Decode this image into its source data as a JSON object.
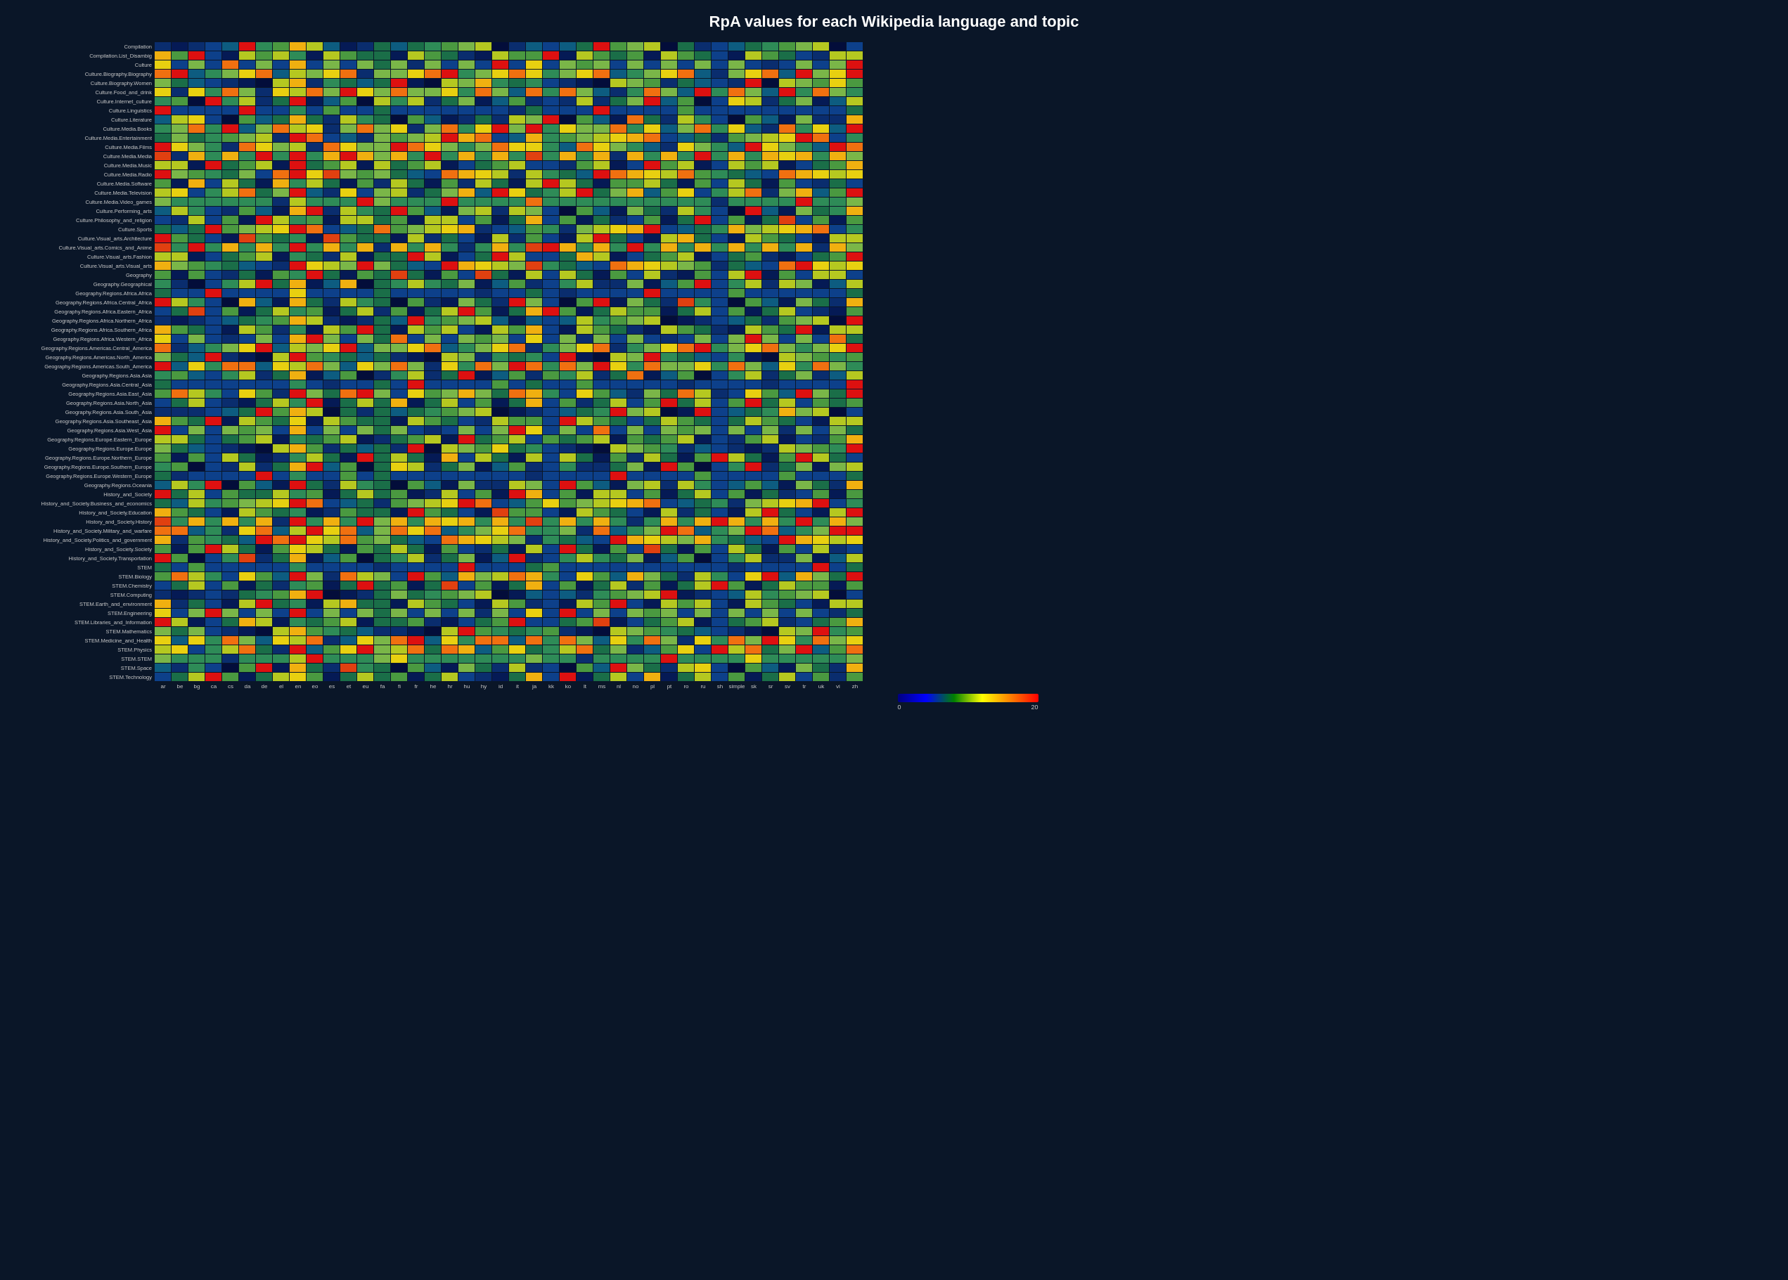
{
  "title": "RpA values for each Wikipedia language and topic",
  "legend": {
    "min": "0",
    "mid": "20",
    "gradient_start": "#000080",
    "gradient_end": "#ff0000"
  },
  "y_labels": [
    "Compilation",
    "Compilation.List_Disambig",
    "Culture",
    "Culture.Biography.Biography",
    "Culture.Biography.Women",
    "Culture.Food_and_drink",
    "Culture.Internet_culture",
    "Culture.Linguistics",
    "Culture.Literature",
    "Culture.Media.Books",
    "Culture.Media.Entertainment",
    "Culture.Media.Films",
    "Culture.Media.Media",
    "Culture.Media.Music",
    "Culture.Media.Radio",
    "Culture.Media.Software",
    "Culture.Media.Television",
    "Culture.Media.Video_games",
    "Culture.Performing_arts",
    "Culture.Philosophy_and_religion",
    "Culture.Sports",
    "Culture.Visual_arts.Architecture",
    "Culture.Visual_arts.Comics_and_Anime",
    "Culture.Visual_arts.Fashion",
    "Culture.Visual_arts.Visual_arts",
    "Geography",
    "Geography.Geographical",
    "Geography.Regions.Africa.Africa",
    "Geography.Regions.Africa.Central_Africa",
    "Geography.Regions.Africa.Eastern_Africa",
    "Geography.Regions.Africa.Northern_Africa",
    "Geography.Regions.Africa.Southern_Africa",
    "Geography.Regions.Africa.Western_Africa",
    "Geography.Regions.Americas.Central_America",
    "Geography.Regions.Americas.North_America",
    "Geography.Regions.Americas.South_America",
    "Geography.Regions.Asia.Asia",
    "Geography.Regions.Asia.Central_Asia",
    "Geography.Regions.Asia.East_Asia",
    "Geography.Regions.Asia.North_Asia",
    "Geography.Regions.Asia.South_Asia",
    "Geography.Regions.Asia.Southeast_Asia",
    "Geography.Regions.Asia.West_Asia",
    "Geography.Regions.Europe.Eastern_Europe",
    "Geography.Regions.Europe.Europe",
    "Geography.Regions.Europe.Northern_Europe",
    "Geography.Regions.Europe.Southern_Europe",
    "Geography.Regions.Europe.Western_Europe",
    "Geography.Regions.Oceania",
    "History_and_Society",
    "History_and_Society.Business_and_economics",
    "History_and_Society.Education",
    "History_and_Society.History",
    "History_and_Society.Military_and_warfare",
    "History_and_Society.Politics_and_government",
    "History_and_Society.Society",
    "History_and_Society.Transportation",
    "STEM",
    "STEM.Biology",
    "STEM.Chemistry",
    "STEM.Computing",
    "STEM.Earth_and_environment",
    "STEM.Engineering",
    "STEM.Libraries_and_Information",
    "STEM.Mathematics",
    "STEM.Medicine_and_Health",
    "STEM.Physics",
    "STEM.STEM",
    "STEM.Space",
    "STEM.Technology"
  ],
  "x_labels": [
    "ar",
    "be",
    "bg",
    "ca",
    "cs",
    "da",
    "de",
    "el",
    "en",
    "eo",
    "es",
    "et",
    "eu",
    "fa",
    "fi",
    "fr",
    "he",
    "hr",
    "hu",
    "hy",
    "id",
    "it",
    "ja",
    "kk",
    "ko",
    "lt",
    "ms",
    "nl",
    "no",
    "pl",
    "pt",
    "ro",
    "ru",
    "sh",
    "simple",
    "sk",
    "sr",
    "sv",
    "tr",
    "uk",
    "vi",
    "zh"
  ],
  "colors": {
    "v_low": "#030d3a",
    "low": "#0a3060",
    "med_low": "#1a5c38",
    "med": "#2e8b57",
    "med_high": "#7ab648",
    "high": "#e8c020",
    "v_high": "#f07010",
    "max": "#dd2020"
  }
}
